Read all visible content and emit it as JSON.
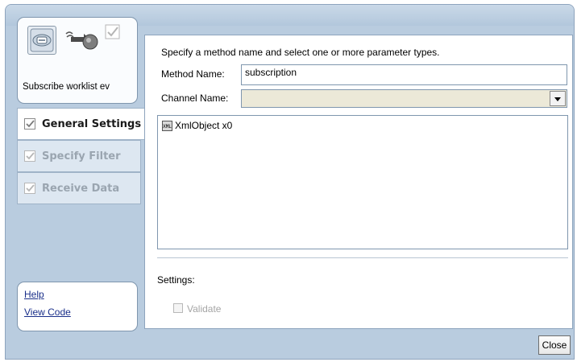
{
  "action": {
    "label": "Subscribe worklist ev"
  },
  "nav": [
    {
      "label": "General Settings",
      "state": "active"
    },
    {
      "label": "Specify Filter",
      "state": "disabled"
    },
    {
      "label": "Receive Data",
      "state": "disabled"
    }
  ],
  "links": {
    "help": "Help",
    "view_code": "View Code"
  },
  "content": {
    "instruction": "Specify a method name and select one or more parameter types.",
    "method_name_label": "Method Name:",
    "method_name_value": "subscription",
    "channel_name_label": "Channel Name:",
    "channel_name_value": "",
    "params": [
      {
        "icon_text": "XML",
        "label": "XmlObject x0"
      }
    ],
    "settings_label": "Settings:",
    "validate_label": "Validate"
  },
  "footer": {
    "close_label": "Close"
  },
  "colors": {
    "window_bg": "#b9ccdf",
    "link": "#1a2f8a",
    "disabled_text": "#9aa5b0"
  }
}
